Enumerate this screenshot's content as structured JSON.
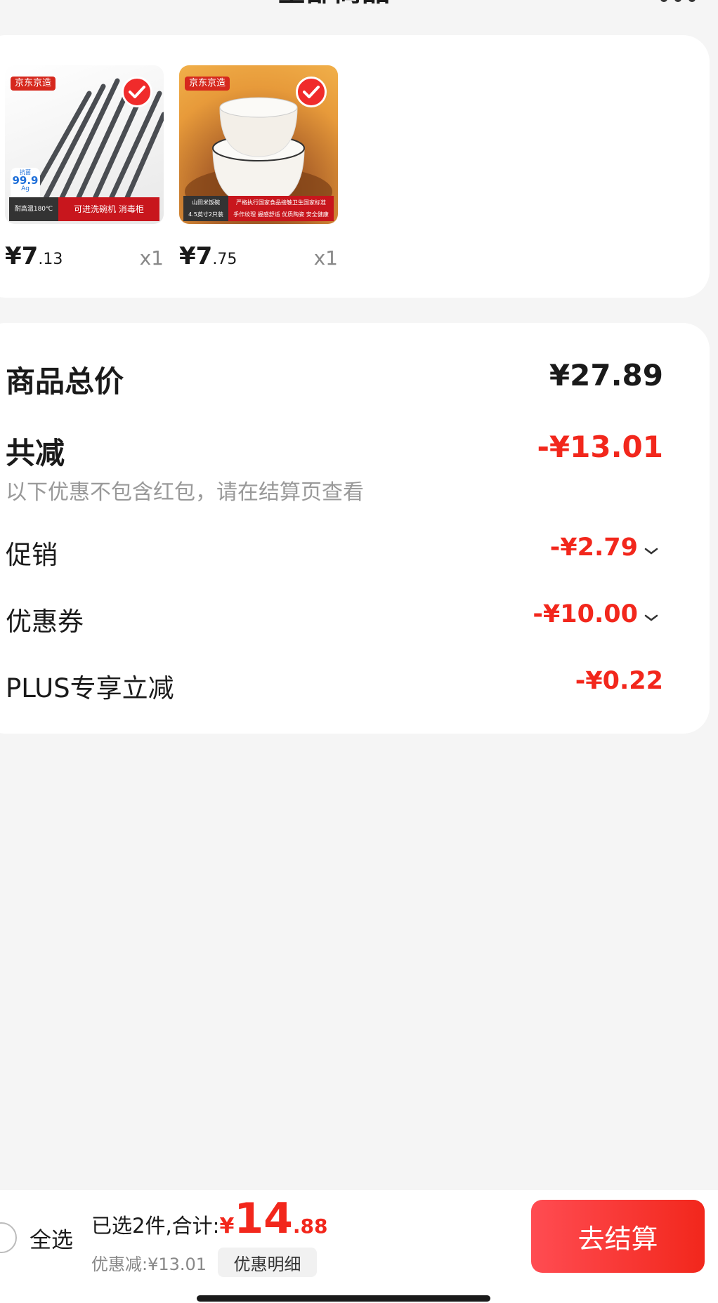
{
  "header": {
    "title": "全部商品"
  },
  "products": [
    {
      "brand": "京东京造",
      "badge_value": "99.9",
      "badge_top": "抗菌",
      "badge_sub": "Ag",
      "strip_left": "耐高温180℃",
      "strip_right": "可进洗碗机 消毒柜",
      "price_int": "¥7",
      "price_dec": ".13",
      "qty": "x1",
      "selected": true
    },
    {
      "brand": "京东京造",
      "strip_left_1": "山田米饭碗",
      "strip_left_2": "4.5英寸2只装",
      "strip_right_1": "严格执行国家食品接触卫生国家标准",
      "strip_right_2": "手作纹理 握感舒适 优质陶瓷 安全健康",
      "price_int": "¥7",
      "price_dec": ".75",
      "qty": "x1",
      "selected": true
    }
  ],
  "summary": {
    "total_label": "商品总价",
    "total_value": "¥27.89",
    "reduce_label": "共减",
    "reduce_value": "-¥13.01",
    "reduce_note": "以下优惠不包含红包，请在结算页查看",
    "lines": [
      {
        "label": "促销",
        "value": "-¥2.79",
        "expandable": true
      },
      {
        "label": "优惠券",
        "value": "-¥10.00",
        "expandable": true
      },
      {
        "label": "PLUS专享立减",
        "value": "-¥0.22",
        "expandable": false
      }
    ]
  },
  "bottom": {
    "select_all": "全选",
    "selected_text": "已选2件,合计:",
    "total_currency": "¥",
    "total_int": "14",
    "total_dec": ".88",
    "discount_text": "优惠减:¥13.01",
    "detail_button": "优惠明细",
    "checkout_button": "去结算"
  },
  "colors": {
    "accent_red": "#f2271c",
    "background": "#f5f5f5"
  }
}
